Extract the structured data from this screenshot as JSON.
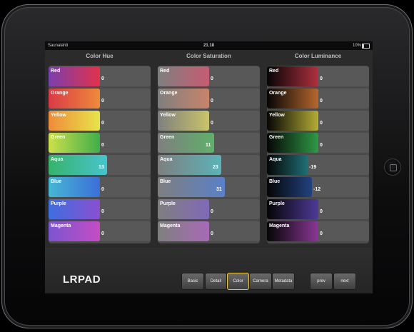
{
  "status": {
    "carrier": "Saunalahti",
    "time": "21.18",
    "battery": "10%"
  },
  "columns": [
    {
      "title": "Color Hue",
      "rows": [
        {
          "label": "Red",
          "value": "0",
          "level": 0.5,
          "color": "linear-gradient(90deg,#7a3fae,#e2314a)"
        },
        {
          "label": "Orange",
          "value": "0",
          "level": 0.5,
          "color": "linear-gradient(90deg,#d93a46,#ef8a3b)"
        },
        {
          "label": "Yellow",
          "value": "0",
          "level": 0.5,
          "color": "linear-gradient(90deg,#ef8b3a,#e7e44b)"
        },
        {
          "label": "Green",
          "value": "0",
          "level": 0.5,
          "color": "linear-gradient(90deg,#cde04a,#3fae4b)"
        },
        {
          "label": "Aqua",
          "value": "13",
          "level": 0.57,
          "color": "linear-gradient(90deg,#37b36c,#47c4cc)"
        },
        {
          "label": "Blue",
          "value": "0",
          "level": 0.5,
          "color": "linear-gradient(90deg,#46b7d3,#3b6fd8)"
        },
        {
          "label": "Purple",
          "value": "0",
          "level": 0.5,
          "color": "linear-gradient(90deg,#3e6ee0,#8a4fd0)"
        },
        {
          "label": "Magenta",
          "value": "0",
          "level": 0.5,
          "color": "linear-gradient(90deg,#7b55d0,#c54dc4)"
        }
      ]
    },
    {
      "title": "Color Saturation",
      "rows": [
        {
          "label": "Red",
          "value": "0",
          "level": 0.5,
          "color": "linear-gradient(90deg,#7f7f7f,#c75c72)"
        },
        {
          "label": "Orange",
          "value": "0",
          "level": 0.5,
          "color": "linear-gradient(90deg,#7f7f7f,#c9836b)"
        },
        {
          "label": "Yellow",
          "value": "0",
          "level": 0.5,
          "color": "linear-gradient(90deg,#7f7f7f,#c9c46a)"
        },
        {
          "label": "Green",
          "value": "11",
          "level": 0.55,
          "color": "linear-gradient(90deg,#7f7f7f,#5fb06a)"
        },
        {
          "label": "Aqua",
          "value": "23",
          "level": 0.62,
          "color": "linear-gradient(90deg,#7f7f7f,#5bb3b7)"
        },
        {
          "label": "Blue",
          "value": "31",
          "level": 0.66,
          "color": "linear-gradient(90deg,#7f7f7f,#5a80c9)"
        },
        {
          "label": "Purple",
          "value": "0",
          "level": 0.5,
          "color": "linear-gradient(90deg,#7f7f7f,#8069b8)"
        },
        {
          "label": "Magenta",
          "value": "0",
          "level": 0.5,
          "color": "linear-gradient(90deg,#7f7f7f,#a86ab6)"
        }
      ]
    },
    {
      "title": "Color Luminance",
      "rows": [
        {
          "label": "Red",
          "value": "0",
          "level": 0.5,
          "color": "linear-gradient(90deg,#050505,#b0303e)"
        },
        {
          "label": "Orange",
          "value": "0",
          "level": 0.5,
          "color": "linear-gradient(90deg,#050505,#b7672e)"
        },
        {
          "label": "Yellow",
          "value": "0",
          "level": 0.5,
          "color": "linear-gradient(90deg,#050505,#b5ae35)"
        },
        {
          "label": "Green",
          "value": "0",
          "level": 0.5,
          "color": "linear-gradient(90deg,#050505,#2f9a46)"
        },
        {
          "label": "Aqua",
          "value": "-19",
          "level": 0.4,
          "color": "linear-gradient(90deg,#050505,#1f6f74)"
        },
        {
          "label": "Blue",
          "value": "-12",
          "level": 0.44,
          "color": "linear-gradient(90deg,#050505,#22427e)"
        },
        {
          "label": "Purple",
          "value": "0",
          "level": 0.5,
          "color": "linear-gradient(90deg,#050505,#4d3a98)"
        },
        {
          "label": "Magenta",
          "value": "0",
          "level": 0.5,
          "color": "linear-gradient(90deg,#050505,#8a3796)"
        }
      ]
    }
  ],
  "logo": "LRPAD",
  "tabs": [
    {
      "label": "Basic",
      "active": false
    },
    {
      "label": "Detail",
      "active": false
    },
    {
      "label": "Color",
      "active": true
    },
    {
      "label": "Camera",
      "active": false
    },
    {
      "label": "Metadata",
      "active": false
    }
  ],
  "nav": {
    "prev": "prev",
    "next": "next"
  }
}
